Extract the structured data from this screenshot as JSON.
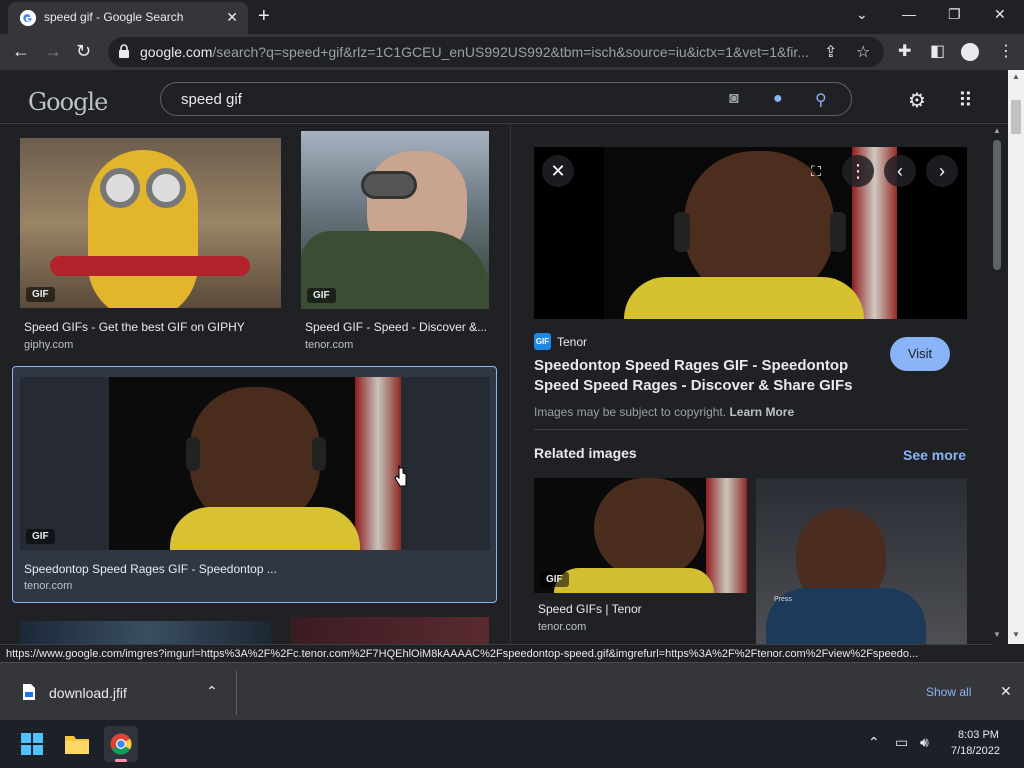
{
  "browser": {
    "tab_title": "speed gif - Google Search",
    "url_host": "google.com",
    "url_path": "/search?q=speed+gif&rlz=1C1GCEU_enUS992US992&tbm=isch&source=iu&ictx=1&vet=1&fir..."
  },
  "google": {
    "search_query": "speed gif"
  },
  "results": [
    {
      "title": "Speed GIFs - Get the best GIF on GIPHY",
      "source": "giphy.com",
      "badge": "GIF"
    },
    {
      "title": "Speed GIF - Speed - Discover &...",
      "source": "tenor.com",
      "badge": "GIF"
    },
    {
      "title": "Speedontop Speed Rages GIF - Speedontop ...",
      "source": "tenor.com",
      "badge": "GIF"
    }
  ],
  "panel": {
    "source_badge": "GIF",
    "source_name": "Tenor",
    "title": "Speedontop Speed Rages GIF - Speedontop Speed Speed Rages - Discover & Share GIFs",
    "visit_label": "Visit",
    "copyright_note": "Images may be subject to copyright.",
    "learn_more": "Learn More",
    "related_heading": "Related images",
    "see_more": "See more",
    "related": [
      {
        "title": "Speed GIFs | Tenor",
        "source": "tenor.com",
        "badge": "GIF"
      }
    ],
    "related_overlay_text": "Press"
  },
  "status_url": "https://www.google.com/imgres?imgurl=https%3A%2F%2Fc.tenor.com%2F7HQEhlOiM8kAAAAC%2Fspeedontop-speed.gif&imgrefurl=https%3A%2F%2Ftenor.com%2Fview%2Fspeedo...",
  "downloads": {
    "file_name": "download.jfif",
    "show_all": "Show all"
  },
  "taskbar": {
    "time": "8:03 PM",
    "date": "7/18/2022"
  }
}
